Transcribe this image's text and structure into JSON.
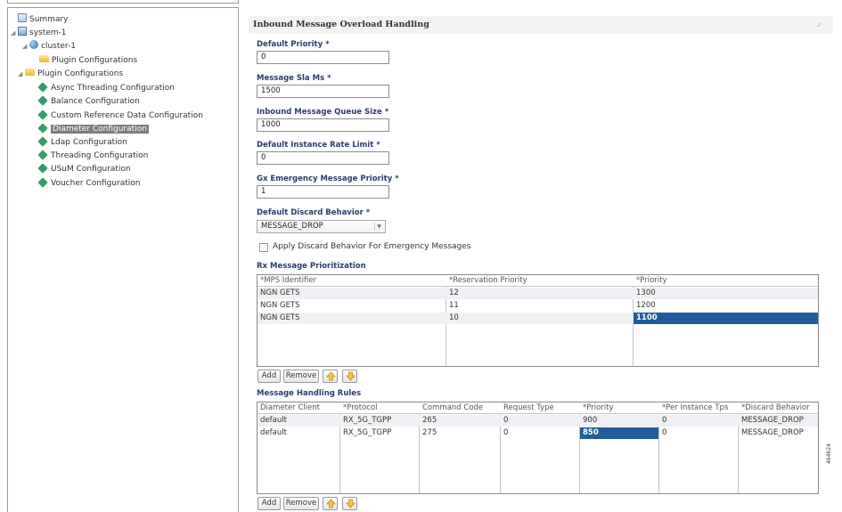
{
  "tree": {
    "summary": "Summary",
    "system": "system-1",
    "cluster": "cluster-1",
    "cluster_plugin_folder": "Plugin Configurations",
    "plugin_folder": "Plugin Configurations",
    "plugins": [
      "Async Threading Configuration",
      "Balance Configuration",
      "Custom Reference Data Configuration",
      "Diameter Configuration",
      "Ldap Configuration",
      "Threading Configuration",
      "USuM Configuration",
      "Voucher Configuration"
    ],
    "selected": "Diameter Configuration"
  },
  "form": {
    "title": "Inbound Message Overload Handling",
    "fields": [
      {
        "label": "Default Priority *",
        "value": "0"
      },
      {
        "label": "Message Sla Ms *",
        "value": "1500"
      },
      {
        "label": "Inbound Message Queue Size *",
        "value": "1000"
      },
      {
        "label": "Default Instance Rate Limit *",
        "value": "0"
      },
      {
        "label": "Gx Emergency Message Priority *",
        "value": "1"
      }
    ],
    "discard_label": "Default Discard Behavior *",
    "discard_value": "MESSAGE_DROP",
    "emergency_checkbox_label": "Apply Discard Behavior For Emergency Messages",
    "emergency_checked": false
  },
  "rx_table": {
    "title": "Rx Message Prioritization",
    "columns": [
      "*MPS Identifier",
      "*Reservation Priority",
      "*Priority"
    ],
    "rows": [
      [
        "NGN GETS",
        "12",
        "1300"
      ],
      [
        "NGN GETS",
        "11",
        "1200"
      ],
      [
        "NGN GETS",
        "10",
        "1100"
      ]
    ],
    "add_label": "Add",
    "remove_label": "Remove"
  },
  "rules_table": {
    "title": "Message Handling Rules",
    "columns": [
      "Diameter Client",
      "*Protocol",
      "Command Code",
      "Request Type",
      "*Priority",
      "*Per Instance Tps",
      "*Discard Behavior"
    ],
    "rows": [
      [
        "default",
        "RX_5G_TGPP",
        "265",
        "0",
        "900",
        "0",
        "MESSAGE_DROP"
      ],
      [
        "default",
        "RX_5G_TGPP",
        "275",
        "0",
        "850",
        "0",
        "MESSAGE_DROP"
      ]
    ],
    "add_label": "Add",
    "remove_label": "Remove"
  },
  "figure_id": "464624",
  "colors": {
    "selection": "#1f5c99",
    "label": "#2a3e6a"
  }
}
